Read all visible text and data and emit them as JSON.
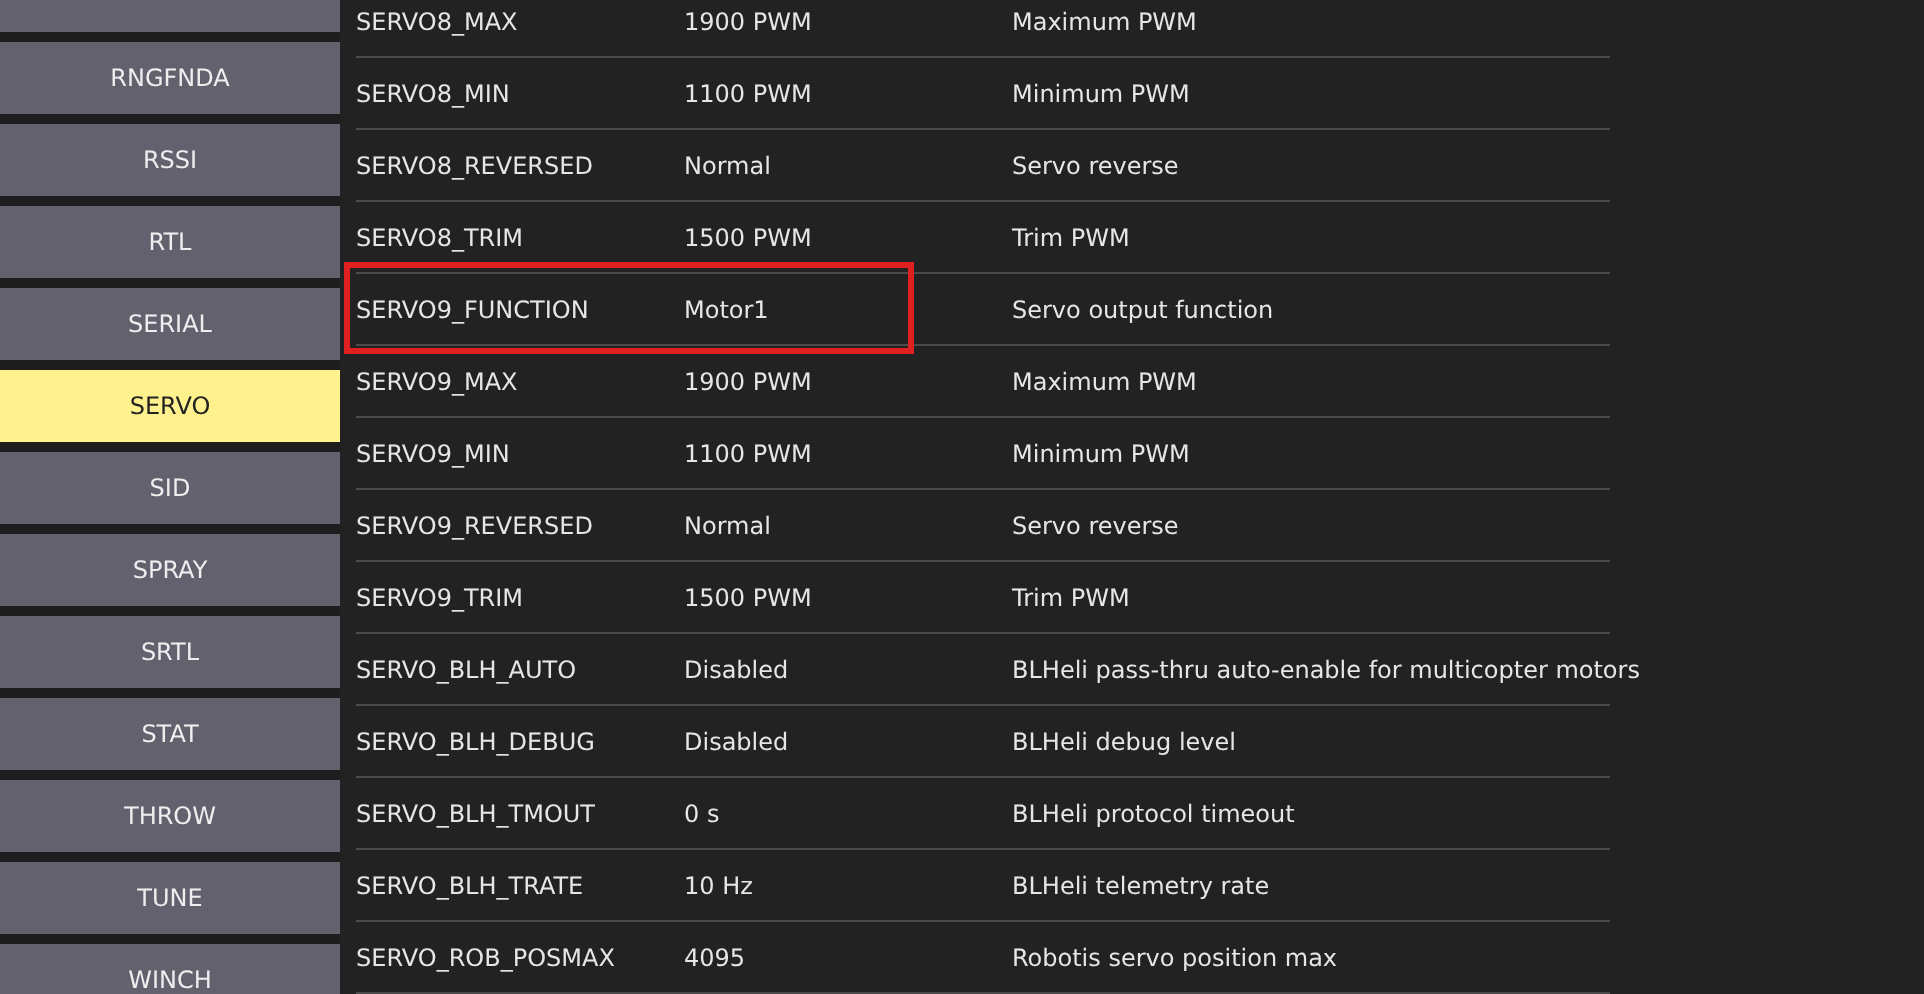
{
  "sidebar": {
    "items": [
      {
        "selected": false
      },
      {
        "label": "RNGFNDA",
        "selected": false
      },
      {
        "label": "RSSI",
        "selected": false
      },
      {
        "label": "RTL",
        "selected": false
      },
      {
        "label": "SERIAL",
        "selected": false
      },
      {
        "label": "SERVO",
        "selected": true
      },
      {
        "label": "SID",
        "selected": false
      },
      {
        "label": "SPRAY",
        "selected": false
      },
      {
        "label": "SRTL",
        "selected": false
      },
      {
        "label": "STAT",
        "selected": false
      },
      {
        "label": "THROW",
        "selected": false
      },
      {
        "label": "TUNE",
        "selected": false
      },
      {
        "label": "WINCH",
        "selected": false
      }
    ]
  },
  "params": {
    "rows": [
      {
        "name": "SERVO8_MAX",
        "value": "1900 PWM",
        "description": "Maximum PWM",
        "highlighted": false
      },
      {
        "name": "SERVO8_MIN",
        "value": "1100 PWM",
        "description": "Minimum PWM",
        "highlighted": false
      },
      {
        "name": "SERVO8_REVERSED",
        "value": "Normal",
        "description": "Servo reverse",
        "highlighted": false
      },
      {
        "name": "SERVO8_TRIM",
        "value": "1500 PWM",
        "description": "Trim PWM",
        "highlighted": false
      },
      {
        "name": "SERVO9_FUNCTION",
        "value": "Motor1",
        "description": "Servo output function",
        "highlighted": true
      },
      {
        "name": "SERVO9_MAX",
        "value": "1900 PWM",
        "description": "Maximum PWM",
        "highlighted": false
      },
      {
        "name": "SERVO9_MIN",
        "value": "1100 PWM",
        "description": "Minimum PWM",
        "highlighted": false
      },
      {
        "name": "SERVO9_REVERSED",
        "value": "Normal",
        "description": "Servo reverse",
        "highlighted": false
      },
      {
        "name": "SERVO9_TRIM",
        "value": "1500 PWM",
        "description": "Trim PWM",
        "highlighted": false
      },
      {
        "name": "SERVO_BLH_AUTO",
        "value": "Disabled",
        "description": "BLHeli pass-thru auto-enable for multicopter motors",
        "highlighted": false
      },
      {
        "name": "SERVO_BLH_DEBUG",
        "value": "Disabled",
        "description": "BLHeli debug level",
        "highlighted": false
      },
      {
        "name": "SERVO_BLH_TMOUT",
        "value": "0 s",
        "description": "BLHeli protocol timeout",
        "highlighted": false
      },
      {
        "name": "SERVO_BLH_TRATE",
        "value": "10 Hz",
        "description": "BLHeli telemetry rate",
        "highlighted": false
      },
      {
        "name": "SERVO_ROB_POSMAX",
        "value": "4095",
        "description": "Robotis servo position max",
        "highlighted": false
      }
    ]
  }
}
